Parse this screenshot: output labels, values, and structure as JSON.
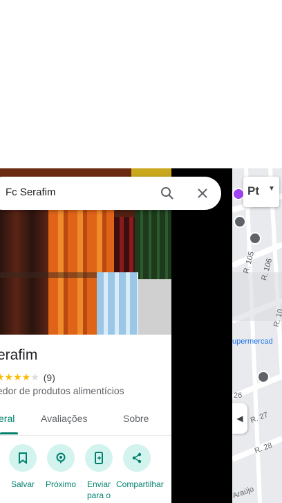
{
  "search": {
    "value": "Fc Serafim"
  },
  "place": {
    "title": "erafim",
    "rating_count": "(9)",
    "category": "edor de produtos alimentícios",
    "stars_filled": 4,
    "stars_total": 5
  },
  "tabs": [
    {
      "label": "eral"
    },
    {
      "label": "Avaliações"
    },
    {
      "label": "Sobre"
    }
  ],
  "actions": [
    {
      "label": "Salvar",
      "icon": "bookmark-icon"
    },
    {
      "label": "Próximo",
      "icon": "nearby-icon"
    },
    {
      "label": "Enviar para o",
      "icon": "send-to-phone-icon"
    },
    {
      "label": "Compartilhar",
      "icon": "share-icon"
    }
  ],
  "map": {
    "layer_label": "Pt",
    "labels": [
      "R. 105",
      "R. 106",
      "R. 10",
      "upermercad",
      "26",
      "R. 27",
      "R. 28",
      "Araújo"
    ]
  },
  "colors": {
    "accent": "#00806d",
    "action_bg": "#d2f3ee",
    "star": "#fbbc04"
  }
}
